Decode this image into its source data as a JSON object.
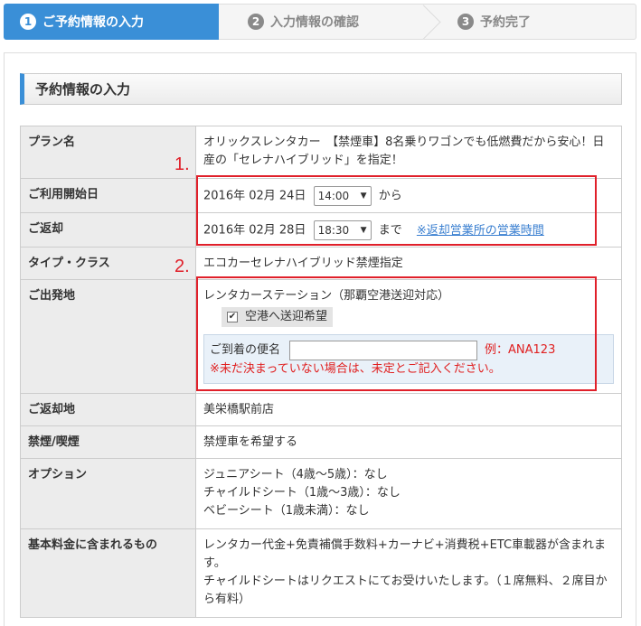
{
  "steps": [
    {
      "num": "1",
      "label": "ご予約情報の入力"
    },
    {
      "num": "2",
      "label": "入力情報の確認"
    },
    {
      "num": "3",
      "label": "予約完了"
    }
  ],
  "section": {
    "title": "予約情報の入力"
  },
  "rows": {
    "plan": {
      "label": "プラン名",
      "value": "オリックスレンタカー　【禁煙車】8名乗りワゴンでも低燃費だから安心！日産の「セレナハイブリッド」を指定！"
    },
    "start": {
      "label": "ご利用開始日",
      "date": "2016年 02月 24日",
      "time": "14:00",
      "suffix": "から"
    },
    "return": {
      "label": "ご返却",
      "date": "2016年 02月 28日",
      "time": "18:30",
      "suffix": "まで",
      "link": "※返却営業所の営業時間"
    },
    "type": {
      "label": "タイプ・クラス",
      "value": "エコカーセレナハイブリッド禁煙指定"
    },
    "departure": {
      "label": "ご出発地",
      "station": "レンタカーステーション（那覇空港送迎対応）",
      "checkbox_label": "空港へ送迎希望",
      "flight_label": "ご到着の便名",
      "flight_value": "",
      "flight_example": "例：ANA123",
      "flight_note": "※未だ決まっていない場合は、未定とご記入ください。"
    },
    "return_place": {
      "label": "ご返却地",
      "value": "美栄橋駅前店"
    },
    "smoking": {
      "label": "禁煙/喫煙",
      "value": "禁煙車を希望する"
    },
    "options": {
      "label": "オプション",
      "lines": [
        "ジュニアシート（4歳～5歳）：なし",
        "チャイルドシート（1歳～3歳）：なし",
        "ベビーシート（1歳未満）：なし"
      ]
    },
    "included": {
      "label": "基本料金に含まれるもの",
      "lines": [
        "レンタカー代金+免責補償手数料+カーナビ+消費税+ETC車載器が含まれます。",
        "チャイルドシートはリクエストにてお受けいたします。（１席無料、２席目から有料）"
      ]
    }
  },
  "annotations": {
    "one": "1.",
    "two": "2."
  },
  "colors": {
    "accent": "#3a8fd7",
    "annotation": "#e0202a",
    "warning": "#e02020"
  }
}
